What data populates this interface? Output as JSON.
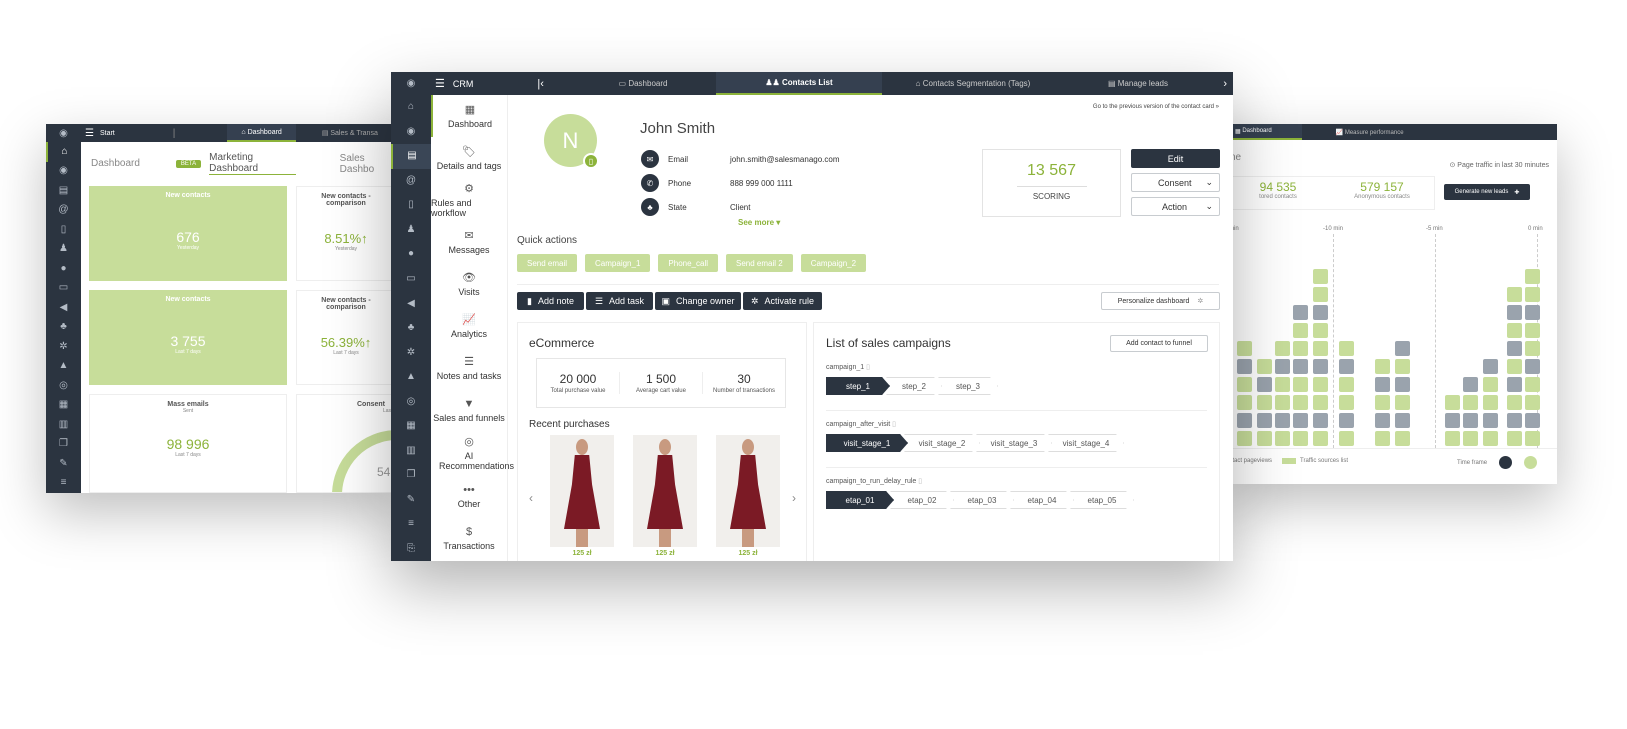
{
  "left_window": {
    "topbar": {
      "start": "Start",
      "dashboard_tab": "Dashboard",
      "sales_tab": "Sales & Transa"
    },
    "tabs": {
      "dashboard": "Dashboard",
      "beta_badge": "BETA",
      "marketing": "Marketing Dashboard",
      "sales": "Sales Dashbo"
    },
    "tiles": [
      {
        "title": "New contacts",
        "value": "676",
        "sub": "Yesterday"
      },
      {
        "title": "New contacts - comparison",
        "value": "8.51%↑",
        "sub": "Yesterday"
      },
      {
        "title": "New contacts",
        "value": "3 755",
        "sub": "Last 7 days"
      },
      {
        "title": "New contacts - comparison",
        "value": "56.39%↑",
        "sub": "Last 7 days"
      },
      {
        "title": "Mass emails",
        "sub1": "Sent",
        "value": "98 996",
        "sub": "Last 7 days"
      },
      {
        "title": "Consent",
        "sub1": "Las",
        "value": "54"
      }
    ]
  },
  "main_window": {
    "topbar": {
      "app": "CRM",
      "tabs": [
        {
          "label": "Dashboard",
          "icon": "monitor-icon"
        },
        {
          "label": "Contacts List",
          "icon": "users-icon"
        },
        {
          "label": "Contacts Segmentation (Tags)",
          "icon": "tags-icon"
        },
        {
          "label": "Manage leads",
          "icon": "id-card-icon"
        }
      ]
    },
    "side_menu": [
      {
        "label": "Dashboard",
        "icon": "▦"
      },
      {
        "label": "Details and tags",
        "icon": "🏷"
      },
      {
        "label": "Rules and workflow",
        "icon": "⚙"
      },
      {
        "label": "Messages",
        "icon": "✉"
      },
      {
        "label": "Visits",
        "icon": "👁"
      },
      {
        "label": "Analytics",
        "icon": "📈"
      },
      {
        "label": "Notes and tasks",
        "icon": "☰"
      },
      {
        "label": "Sales and funnels",
        "icon": "▼"
      },
      {
        "label": "AI Recommendations",
        "icon": "◎"
      },
      {
        "label": "Other",
        "icon": "•••"
      },
      {
        "label": "Transactions",
        "icon": "$"
      }
    ],
    "prev_version_link": "Go to the previous version of the contact card »",
    "contact": {
      "initial": "N",
      "name": "John Smith",
      "email_label": "Email",
      "email": "john.smith@salesmanago.com",
      "phone_label": "Phone",
      "phone": "888 999 000 1111",
      "state_label": "State",
      "state": "Client",
      "see_more": "See more ▾"
    },
    "scoring": {
      "value": "13 567",
      "label": "SCORING"
    },
    "buttons": {
      "edit": "Edit",
      "consent": "Consent",
      "action": "Action"
    },
    "quick_actions": {
      "title": "Quick actions",
      "items": [
        "Send email",
        "Campaign_1",
        "Phone_call",
        "Send email 2",
        "Campaign_2"
      ]
    },
    "toolbar": {
      "add_note": "Add note",
      "add_task": "Add task",
      "change_owner": "Change owner",
      "activate_rule": "Activate rule",
      "personalize": "Personalize dashboard"
    },
    "ecommerce": {
      "title": "eCommerce",
      "stats": [
        {
          "value": "20 000",
          "label": "Total purchase value"
        },
        {
          "value": "1 500",
          "label": "Average cart value"
        },
        {
          "value": "30",
          "label": "Number of transactions"
        }
      ],
      "recent_title": "Recent purchases",
      "products": [
        {
          "price": "125 zł"
        },
        {
          "price": "125 zł"
        },
        {
          "price": "125 zł"
        }
      ]
    },
    "campaigns": {
      "title": "List of sales campaigns",
      "add_button": "Add contact to funnel",
      "list": [
        {
          "name": "campaign_1",
          "steps": [
            "step_1",
            "step_2",
            "step_3"
          ]
        },
        {
          "name": "campaign_after_visit",
          "steps": [
            "visit_stage_1",
            "visit_stage_2",
            "visit_stage_3",
            "visit_stage_4"
          ]
        },
        {
          "name": "campaign_to_run_delay_rule",
          "steps": [
            "etap_01",
            "etap_02",
            "etap_03",
            "etap_04",
            "etap_05"
          ]
        }
      ]
    }
  },
  "right_window": {
    "tabs": {
      "dashboard": "Dashboard",
      "measure": "Measure performance"
    },
    "heading": "ne",
    "traffic_note": "Page traffic in last 30 minutes",
    "stats": [
      {
        "value": "94 535",
        "label": "tored contacts"
      },
      {
        "value": "579 157",
        "label": "Anonymous contacts"
      }
    ],
    "generate_button": "Generate new leads",
    "axis": [
      "min",
      "-10 min",
      "-5 min",
      "0 min"
    ],
    "legend": {
      "pageviews": "ntact pageviews",
      "traffic": "Traffic sources list",
      "time_frame": "Time frame"
    }
  }
}
